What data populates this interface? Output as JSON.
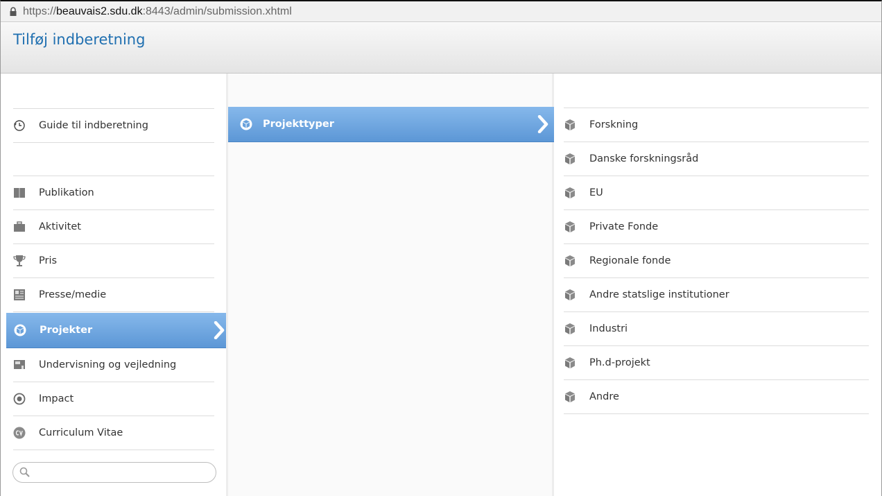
{
  "browser": {
    "url_prefix": "https://",
    "url_host": "beauvais2.sdu.dk",
    "url_rest": ":8443/admin/submission.xhtml"
  },
  "page": {
    "title": "Tilføj indberetning"
  },
  "left_menu": {
    "guide": "Guide til indberetning",
    "items": [
      {
        "label": "Publikation",
        "icon": "book-icon"
      },
      {
        "label": "Aktivitet",
        "icon": "briefcase-icon"
      },
      {
        "label": "Pris",
        "icon": "trophy-icon"
      },
      {
        "label": "Presse/medie",
        "icon": "newspaper-icon"
      },
      {
        "label": "Projekter",
        "icon": "cube-icon",
        "active": true
      },
      {
        "label": "Undervisning og vejledning",
        "icon": "blackboard-icon"
      },
      {
        "label": "Impact",
        "icon": "target-icon"
      },
      {
        "label": "Curriculum Vitae",
        "icon": "cv-icon"
      }
    ],
    "search_placeholder": ""
  },
  "middle_menu": {
    "active_label": "Projekttyper"
  },
  "right_menu": {
    "items": [
      "Forskning",
      "Danske forskningsråd",
      "EU",
      "Private Fonde",
      "Regionale fonde",
      "Andre statslige institutioner",
      "Industri",
      "Ph.d-projekt",
      "Andre"
    ]
  },
  "colors": {
    "title": "#1f6fb0",
    "active_top": "#86b8eb",
    "active_bottom": "#5c97d6",
    "icon_gray": "#8a8a8a"
  }
}
